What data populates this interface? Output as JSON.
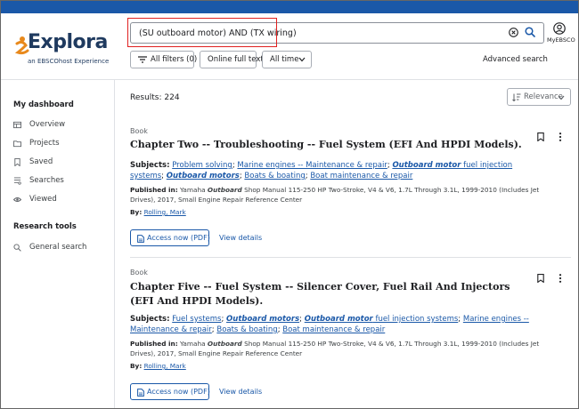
{
  "brand": {
    "name": "Explora",
    "tagline": "an EBSCOhost Experience"
  },
  "search": {
    "value": "(SU outboard motor) AND (TX wiring)"
  },
  "account": {
    "label": "MyEBSCO"
  },
  "filters": {
    "all_filters": "All filters (0)",
    "full_text": "Online full text",
    "time": "All time",
    "advanced": "Advanced search"
  },
  "sidebar": {
    "dashboard_heading": "My dashboard",
    "dashboard_items": [
      {
        "label": "Overview",
        "icon": "overview-icon"
      },
      {
        "label": "Projects",
        "icon": "folder-icon"
      },
      {
        "label": "Saved",
        "icon": "bookmark-icon"
      },
      {
        "label": "Searches",
        "icon": "history-icon"
      },
      {
        "label": "Viewed",
        "icon": "eye-icon"
      }
    ],
    "research_heading": "Research tools",
    "research_items": [
      {
        "label": "General search",
        "icon": "search-icon"
      }
    ]
  },
  "results": {
    "count_label": "Results: 224",
    "sort_label": "Relevance",
    "subjects_label": "Subjects:",
    "published_label": "Published in:",
    "by_label": "By:",
    "access_label": "Access now (PDF)",
    "view_details": "View details",
    "items": [
      {
        "type": "Book",
        "title": "Chapter Two -- Troubleshooting -- Fuel System (EFI And HPDI Models).",
        "subjects": [
          {
            "pre": "Problem solving",
            "em": "",
            "post": ""
          },
          {
            "pre": "Marine engines -- Maintenance & repair",
            "em": "",
            "post": ""
          },
          {
            "pre": "",
            "em": "Outboard motor",
            "post": " fuel injection systems"
          },
          {
            "pre": "",
            "em": "Outboard motors",
            "post": ""
          },
          {
            "pre": "Boats & boating",
            "em": "",
            "post": ""
          },
          {
            "pre": "Boat maintenance & repair",
            "em": "",
            "post": ""
          }
        ],
        "published_pre": "Yamaha ",
        "published_em": "Outboard",
        "published_post": " Shop Manual 115-250 HP Two-Stroke, V4 & V6, 1.7L Through 3.1L, 1999-2010 (Includes Jet Drives), 2017, Small Engine Repair Reference Center",
        "author": "Rolling, Mark"
      },
      {
        "type": "Book",
        "title": "Chapter Five -- Fuel System -- Silencer Cover, Fuel Rail And Injectors (EFI And HPDI Models).",
        "subjects": [
          {
            "pre": "Fuel systems",
            "em": "",
            "post": ""
          },
          {
            "pre": "",
            "em": "Outboard motors",
            "post": ""
          },
          {
            "pre": "",
            "em": "Outboard motor",
            "post": " fuel injection systems"
          },
          {
            "pre": "Marine engines -- Maintenance & repair",
            "em": "",
            "post": ""
          },
          {
            "pre": "Boats & boating",
            "em": "",
            "post": ""
          },
          {
            "pre": "Boat maintenance & repair",
            "em": "",
            "post": ""
          }
        ],
        "published_pre": "Yamaha ",
        "published_em": "Outboard",
        "published_post": " Shop Manual 115-250 HP Two-Stroke, V4 & V6, 1.7L Through 3.1L, 1999-2010 (Includes Jet Drives), 2017, Small Engine Repair Reference Center",
        "author": "Rolling, Mark"
      }
    ]
  },
  "colors": {
    "brand_blue": "#1a58a8",
    "logo_orange": "#e8891c",
    "highlight_red": "#e02020"
  }
}
